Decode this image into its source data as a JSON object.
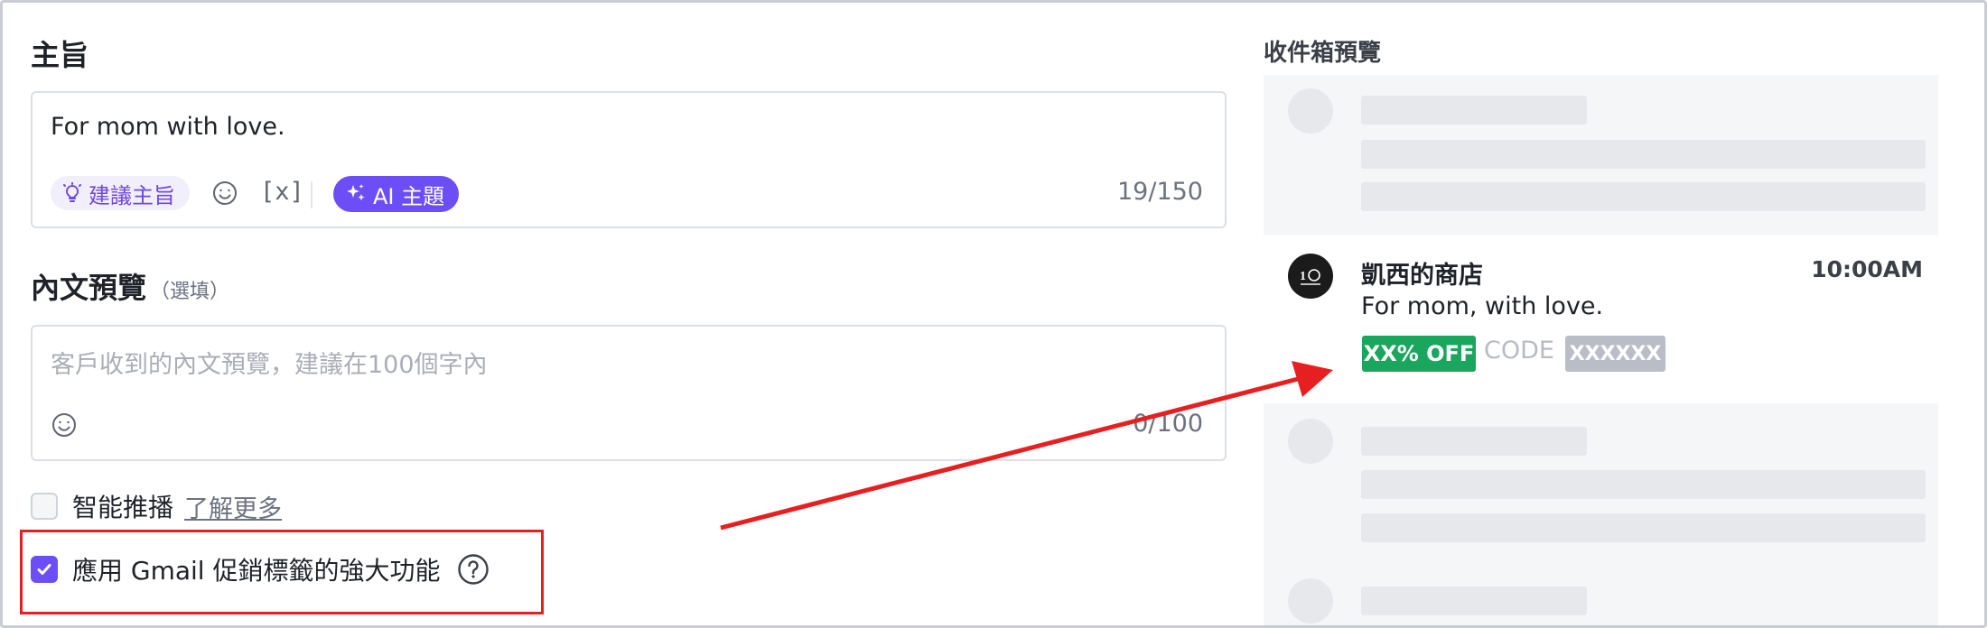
{
  "subject": {
    "title": "主旨",
    "value": "For mom with love.",
    "suggest_label": "建議主旨",
    "var_token": "[x]",
    "ai_label": "AI 主題",
    "counter": "19/150"
  },
  "preheader": {
    "title": "內文預覽",
    "optional": "（選填）",
    "placeholder": "客戶收到的內文預覽，建議在100個字內",
    "counter": "0/100"
  },
  "smart_send": {
    "label": "智能推播",
    "link": "了解更多",
    "checked": false
  },
  "gmail_promo": {
    "label": "應用 Gmail 促銷標籤的強大功能",
    "checked": true
  },
  "inbox_preview": {
    "title": "收件箱預覽",
    "email": {
      "sender": "凱西的商店",
      "time": "10:00AM",
      "subject": "For mom, with love.",
      "discount": "XX% OFF",
      "code_label": "CODE",
      "code": "XXXXXX"
    }
  },
  "colors": {
    "accent": "#6b4ef6",
    "discount_green": "#1aa65c",
    "annotation_red": "#e62020"
  },
  "icons": [
    "lightbulb-icon",
    "emoji-icon",
    "sparkle-icon",
    "checkmark-icon",
    "help-icon",
    "store-logo-icon"
  ]
}
